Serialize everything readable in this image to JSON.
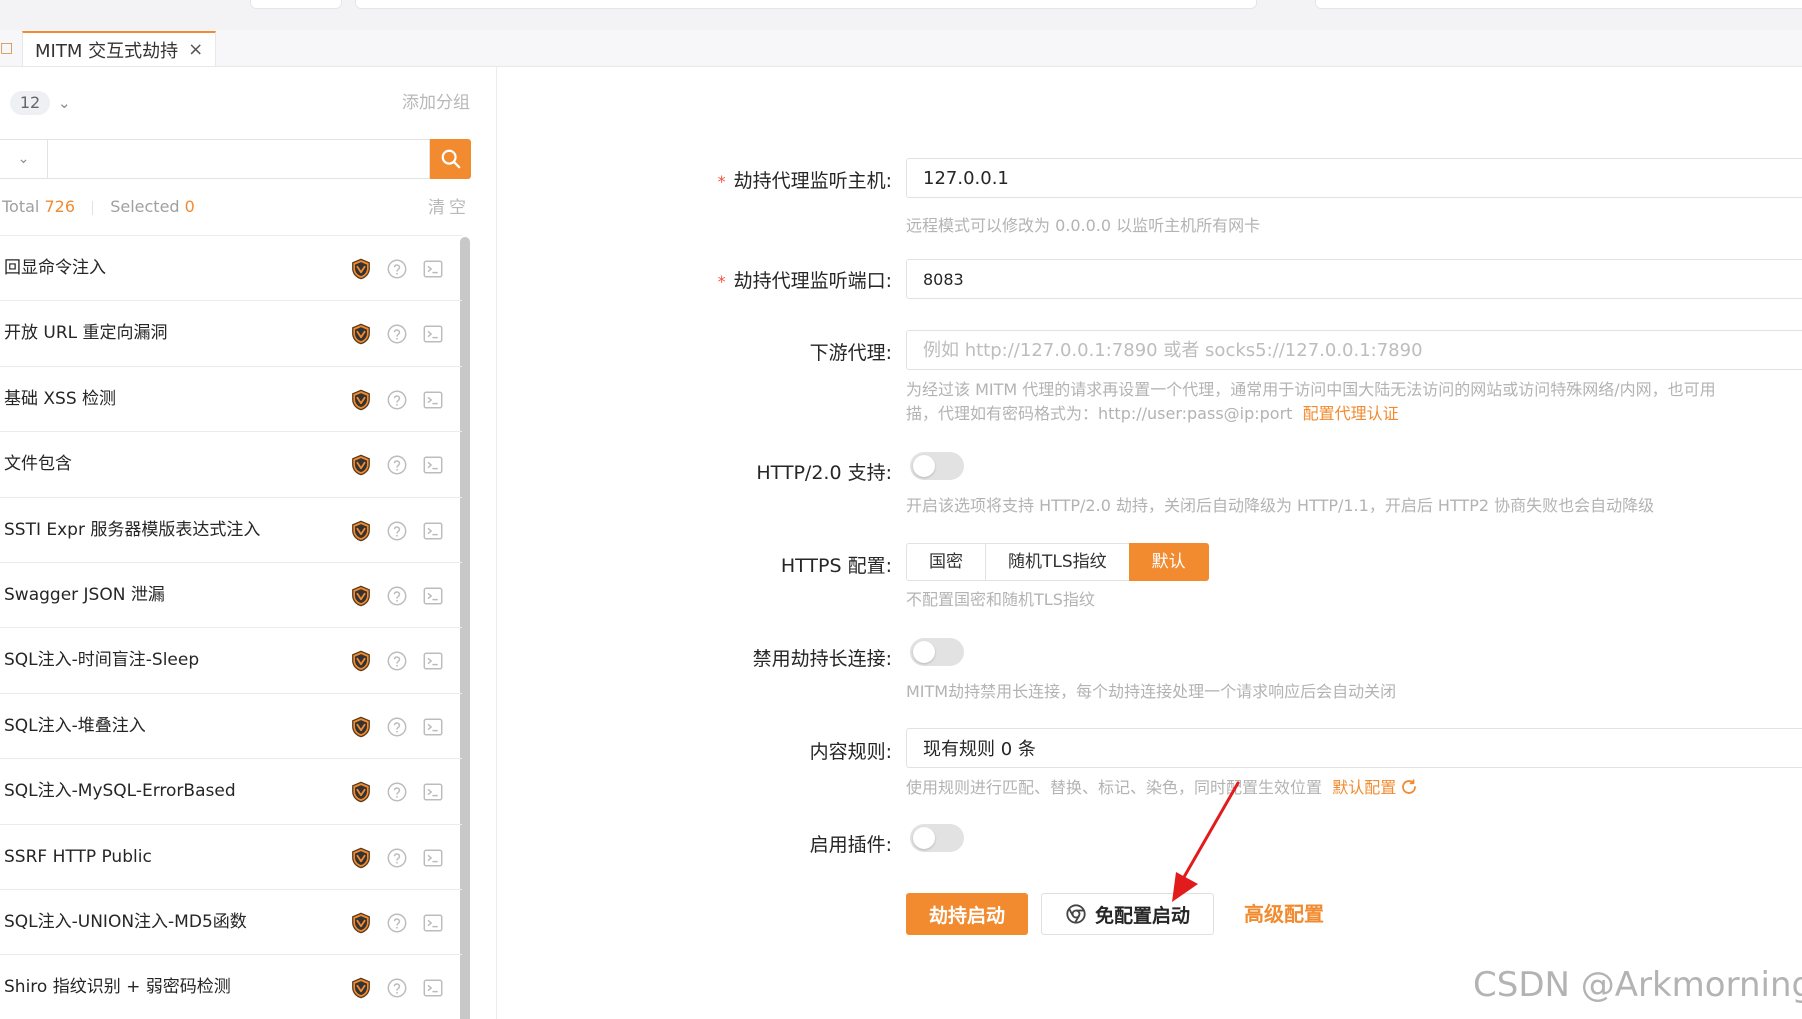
{
  "tabs": [
    {
      "label": "MITM 交互式劫持",
      "close": "×"
    }
  ],
  "sidebar": {
    "group_count": "12",
    "add_group": "添加分组",
    "search": {
      "placeholder": "",
      "value": ""
    },
    "stats": {
      "total_label": "Total",
      "total": "726",
      "selected_label": "Selected",
      "selected": "0"
    },
    "clear": "清空",
    "items": [
      {
        "name": "回显命令注入"
      },
      {
        "name": "开放 URL 重定向漏洞"
      },
      {
        "name": "基础 XSS 检测"
      },
      {
        "name": "文件包含"
      },
      {
        "name": "SSTI Expr 服务器模版表达式注入"
      },
      {
        "name": "Swagger JSON 泄漏"
      },
      {
        "name": "SQL注入-时间盲注-Sleep"
      },
      {
        "name": "SQL注入-堆叠注入"
      },
      {
        "name": "SQL注入-MySQL-ErrorBased"
      },
      {
        "name": "SSRF HTTP Public"
      },
      {
        "name": "SQL注入-UNION注入-MD5函数"
      },
      {
        "name": "Shiro 指纹识别 + 弱密码检测"
      }
    ]
  },
  "form": {
    "host": {
      "label": "劫持代理监听主机:",
      "value": "127.0.0.1",
      "hint": "远程模式可以修改为 0.0.0.0 以监听主机所有网卡"
    },
    "port": {
      "label": "劫持代理监听端口:",
      "value": "8083"
    },
    "downstream": {
      "label": "下游代理:",
      "placeholder": "例如 http://127.0.0.1:7890 或者 socks5://127.0.0.1:7890",
      "hint_line1": "为经过该 MITM 代理的请求再设置一个代理，通常用于访问中国大陆无法访问的网站或访问特殊网络/内网，也可用",
      "hint_line2": "描，代理如有密码格式为：http://user:pass@ip:port",
      "hint_link": "配置代理认证"
    },
    "http2": {
      "label": "HTTP/2.0 支持:",
      "hint": "开启该选项将支持 HTTP/2.0 劫持，关闭后自动降级为 HTTP/1.1，开启后 HTTP2 协商失败也会自动降级"
    },
    "https": {
      "label": "HTTPS 配置:",
      "options": [
        "国密",
        "随机TLS指纹",
        "默认"
      ],
      "selected": "默认",
      "hint": "不配置国密和随机TLS指纹"
    },
    "keepalive": {
      "label": "禁用劫持长连接:",
      "hint": "MITM劫持禁用长连接，每个劫持连接处理一个请求响应后会自动关闭"
    },
    "rules": {
      "label": "内容规则:",
      "value": "现有规则 0 条",
      "hint": "使用规则进行匹配、替换、标记、染色，同时配置生效位置",
      "hint_link": "默认配置"
    },
    "plugins": {
      "label": "启用插件:"
    }
  },
  "actions": {
    "start": "劫持启动",
    "no_config": "免配置启动",
    "advanced": "高级配置"
  },
  "watermark": "CSDN @Arkmornings",
  "colors": {
    "accent": "#f28b30",
    "required": "#f5503f"
  }
}
